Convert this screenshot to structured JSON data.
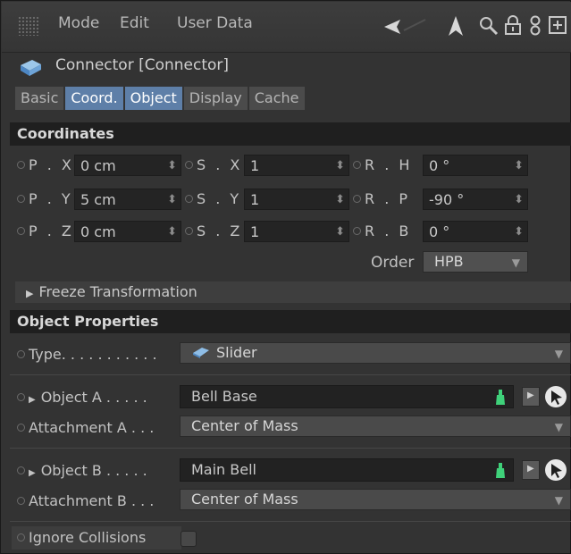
{
  "menu": {
    "items": [
      "Mode",
      "Edit",
      "User Data"
    ]
  },
  "object": {
    "title": "Connector [Connector]"
  },
  "tabs": [
    "Basic",
    "Coord.",
    "Object",
    "Display",
    "Cache"
  ],
  "active_tabs": [
    "Coord.",
    "Object"
  ],
  "coordinates": {
    "section_title": "Coordinates",
    "pos": [
      {
        "label": "P . X",
        "value": "0 cm"
      },
      {
        "label": "P . Y",
        "value": "5 cm"
      },
      {
        "label": "P . Z",
        "value": "0 cm"
      }
    ],
    "scale": [
      {
        "label": "S . X",
        "value": "1"
      },
      {
        "label": "S . Y",
        "value": "1"
      },
      {
        "label": "S . Z",
        "value": "1"
      }
    ],
    "rot": [
      {
        "label": "R . H",
        "value": "0 °"
      },
      {
        "label": "R . P",
        "value": "-90 °"
      },
      {
        "label": "R . B",
        "value": "0 °"
      }
    ],
    "order_label": "Order",
    "order_value": "HPB",
    "freeze_label": "Freeze Transformation"
  },
  "object_properties": {
    "section_title": "Object Properties",
    "type_label": "Type. . . . . . . . . . .",
    "type_value": "Slider",
    "object_a_label": "Object A . . . . .",
    "object_a_value": "Bell Base",
    "attachment_a_label": "Attachment A . . .",
    "attachment_a_value": "Center of Mass",
    "object_b_label": "Object B . . . . .",
    "object_b_value": "Main Bell",
    "attachment_b_label": "Attachment B . . .",
    "attachment_b_value": "Center of Mass",
    "ignore_collisions_label": "Ignore Collisions"
  },
  "colors": {
    "active_tab": "#5e7fa8",
    "green_icon": "#3fd17a"
  },
  "icons": [
    "grip-icon",
    "arrow-left-icon",
    "arrow-up-icon",
    "search-icon",
    "lock-icon",
    "link-icon",
    "add-icon",
    "connector-icon",
    "slider-icon",
    "pick-arrow-icon",
    "object-link-icon"
  ]
}
